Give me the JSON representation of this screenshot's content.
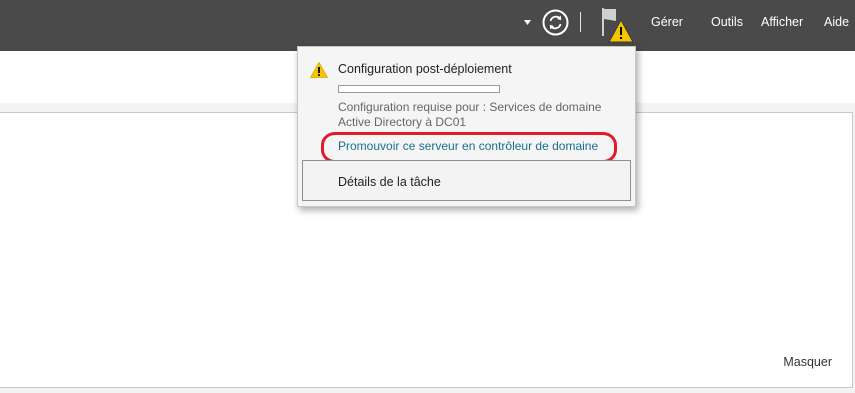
{
  "topbar": {
    "menu": {
      "manage": "Gérer",
      "tools": "Outils",
      "view": "Afficher",
      "help": "Aide"
    },
    "icons": [
      "dropdown-caret-icon",
      "refresh-icon",
      "notification-flag-icon",
      "warning-icon"
    ]
  },
  "notification": {
    "task_title": "Configuration post-déploiement",
    "progress_fraction": 0,
    "description": "Configuration requise pour : Services de domaine Active Directory à DC01",
    "promote_link": "Promouvoir ce serveur en contrôleur de domaine",
    "task_details_button": "Détails de la tâche",
    "highlight_color": "#e21a2a",
    "warning_color": "#f5c400"
  },
  "main": {
    "hide_label": "Masquer"
  }
}
